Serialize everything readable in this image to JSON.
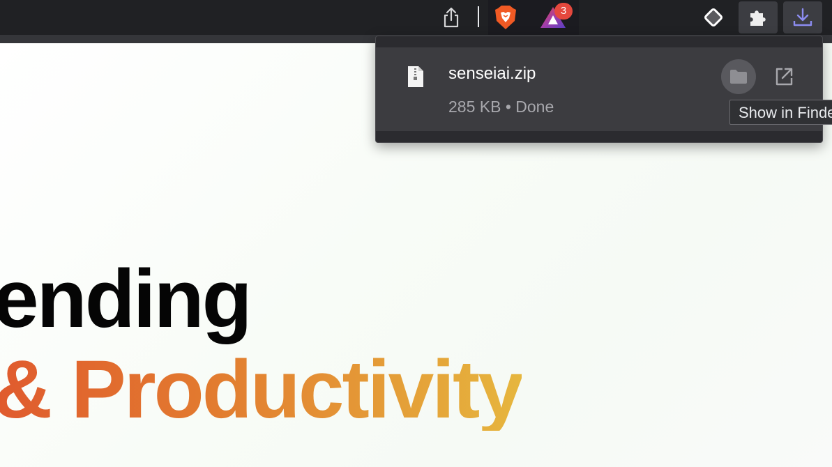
{
  "toolbar": {
    "icons": [
      "share-icon",
      "brave-shields-icon",
      "brave-rewards-icon",
      "extension-diamond-icon",
      "extensions-puzzle-icon",
      "downloads-icon"
    ],
    "rewards_badge_count": "3"
  },
  "downloads": {
    "items": [
      {
        "file_name": "senseiai.zip",
        "status": "285 KB • Done"
      }
    ],
    "tooltip": "Show in Finder"
  },
  "page": {
    "headline_line1": "ending",
    "headline_line2": "& Productivity",
    "headline_gradient": [
      "#e05a2e",
      "#e27a2f",
      "#e6b63e"
    ]
  },
  "colors": {
    "toolbar_bg": "#202124",
    "popup_bg": "#2b2b2f",
    "item_bg": "#3c3c40",
    "downloads_icon_accent": "#8c8cf0"
  }
}
